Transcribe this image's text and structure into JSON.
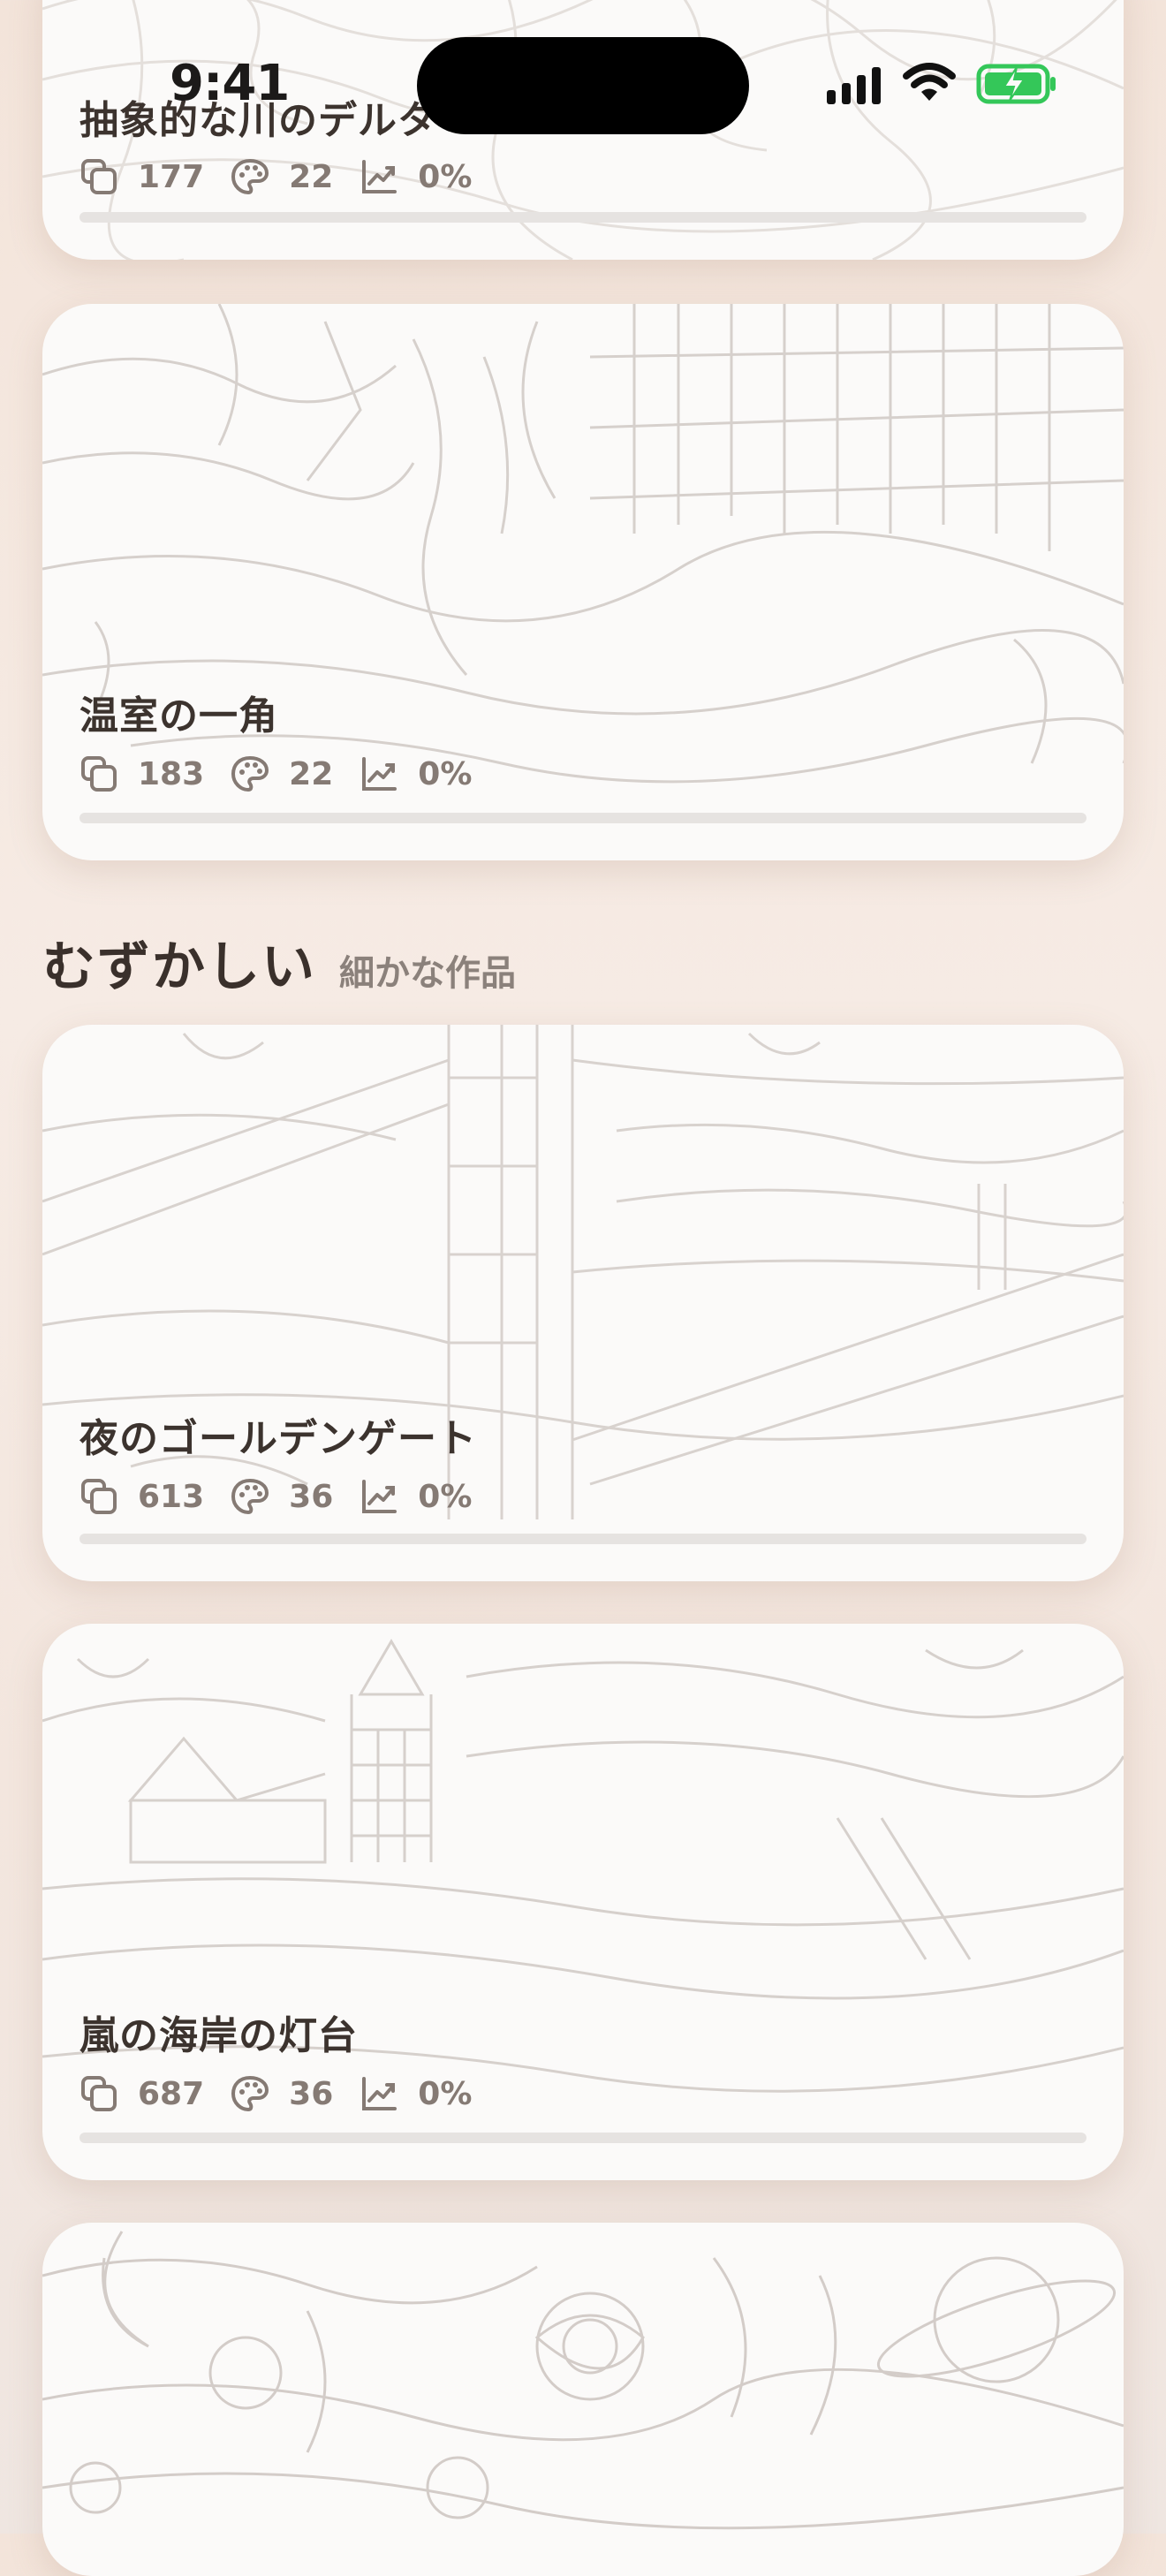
{
  "status_bar": {
    "time": "9:41"
  },
  "cards_top": [
    {
      "title": "抽象的な川のデルタ",
      "shapes": "177",
      "colors": "22",
      "progress": "0%",
      "progress_value": 0
    },
    {
      "title": "温室の一角",
      "shapes": "183",
      "colors": "22",
      "progress": "0%",
      "progress_value": 0
    }
  ],
  "section": {
    "title": "むずかしい",
    "subtitle": "細かな作品"
  },
  "cards_hard": [
    {
      "title": "夜のゴールデンゲート",
      "shapes": "613",
      "colors": "36",
      "progress": "0%",
      "progress_value": 0
    },
    {
      "title": "嵐の海岸の灯台",
      "shapes": "687",
      "colors": "36",
      "progress": "0%",
      "progress_value": 0
    },
    {
      "title": "",
      "shapes": "",
      "colors": "",
      "progress": ""
    }
  ],
  "icons": {
    "shapes": "shapes-icon",
    "colors": "palette-icon",
    "progress": "trend-icon"
  },
  "colors": {
    "accent": "#c9a491",
    "line_art": "#cfc9c5",
    "battery": "#34c759"
  }
}
